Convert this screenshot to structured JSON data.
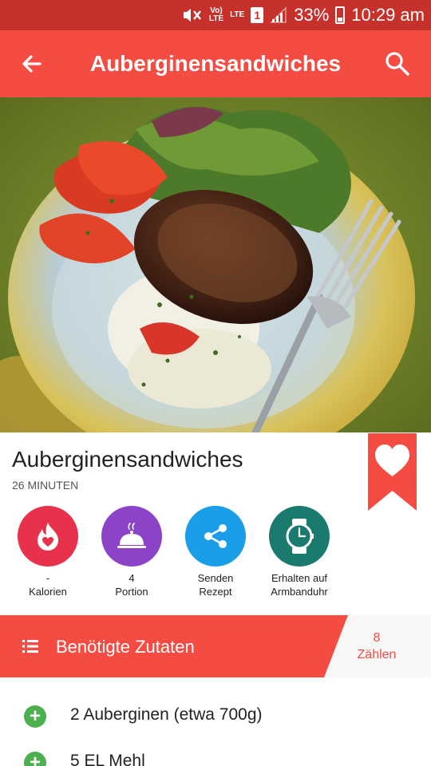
{
  "status_bar": {
    "vo_lte": "Vo)\nLTE",
    "lte": "LTE",
    "sim": "1",
    "battery": "33%",
    "time": "10:29 am"
  },
  "app_bar": {
    "title": "Auberginensandwiches",
    "back_icon": "arrow-left-icon",
    "search_icon": "search-icon"
  },
  "recipe": {
    "title": "Auberginensandwiches",
    "time": "26 MINUTEN",
    "favorite_icon": "heart-icon"
  },
  "actions": [
    {
      "value": "-",
      "label": "Kalorien",
      "icon": "flame-icon",
      "color": "#e8324c"
    },
    {
      "value": "4",
      "label": "Portion",
      "icon": "cloche-icon",
      "color": "#8b44c8"
    },
    {
      "value": "Senden",
      "label": "Rezept",
      "icon": "share-icon",
      "color": "#1a9ee8"
    },
    {
      "value": "Erhalten auf",
      "label": "Armbanduhr",
      "icon": "watch-icon",
      "color": "#1a7a6e"
    }
  ],
  "ingredients_header": {
    "title": "Benötigte Zutaten",
    "count": "8",
    "count_label": "Zählen",
    "icon": "list-icon"
  },
  "ingredients": [
    "2 Auberginen (etwa 700g)",
    "5 EL Mehl"
  ],
  "colors": {
    "primary": "#f44b42",
    "status_bar": "#c7312b",
    "add_green": "#4caf50"
  }
}
